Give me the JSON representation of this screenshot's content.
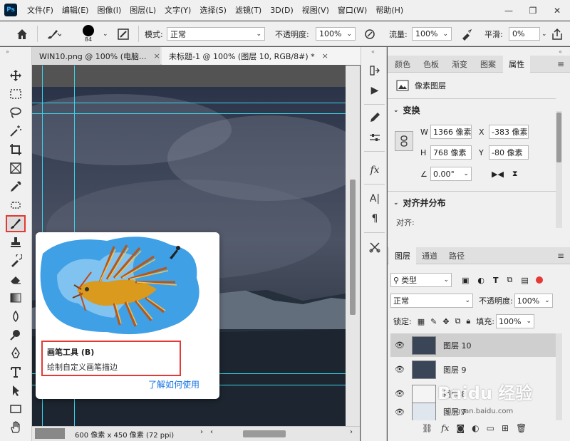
{
  "app": {
    "logo": "Ps",
    "menu": [
      "文件(F)",
      "编辑(E)",
      "图像(I)",
      "图层(L)",
      "文字(Y)",
      "选择(S)",
      "滤镜(T)",
      "3D(D)",
      "视图(V)",
      "窗口(W)",
      "帮助(H)"
    ],
    "window_controls": [
      "minimize-icon",
      "maximize-icon",
      "close-icon"
    ]
  },
  "options_bar": {
    "brush_size": "84",
    "mode_label": "模式:",
    "mode_value": "正常",
    "opacity_label": "不透明度:",
    "opacity_value": "100%",
    "flow_label": "流量:",
    "flow_value": "100%",
    "smooth_label": "平滑:",
    "smooth_value": "0%"
  },
  "tabs": [
    {
      "label": "WIN10.png @ 100% (电脑...",
      "close": "×"
    },
    {
      "label": "未标题-1 @ 100% (图层 10, RGB/8#) *",
      "close": "×"
    }
  ],
  "tooltip": {
    "title": "画笔工具 (B)",
    "description": "绘制自定义画笔描边",
    "link": "了解如何使用"
  },
  "status": {
    "doc_size": "600 像素 x 450 像素 (72 ppi)"
  },
  "properties": {
    "tabs": [
      "颜色",
      "色板",
      "渐变",
      "图案",
      "属性"
    ],
    "active_tab": "属性",
    "layer_type": "像素图层",
    "transform_title": "变换",
    "w_label": "W",
    "w_value": "1366 像素",
    "x_label": "X",
    "x_value": "-383 像素",
    "h_label": "H",
    "h_value": "768 像素",
    "y_label": "Y",
    "y_value": "-80 像素",
    "angle_value": "0.00°",
    "align_title": "对齐并分布",
    "align_label": "对齐:"
  },
  "layers": {
    "tabs": [
      "图层",
      "通道",
      "路径"
    ],
    "filter_kind": "类型",
    "blend_mode": "正常",
    "opacity_label": "不透明度:",
    "opacity_value": "100%",
    "lock_label": "锁定:",
    "fill_label": "填充:",
    "fill_value": "100%",
    "items": [
      {
        "name": "图层 10",
        "selected": true
      },
      {
        "name": "图层 9",
        "selected": false
      },
      {
        "name": "图层 8",
        "selected": false
      },
      {
        "name": "图层 7",
        "selected": false
      }
    ]
  },
  "watermark": {
    "brand": "Baidu 经验",
    "url": "jingyan.baidu.com"
  },
  "colors": {
    "accent_red": "#e53935",
    "link_blue": "#1473e6",
    "guide_cyan": "#3ad4e8"
  }
}
